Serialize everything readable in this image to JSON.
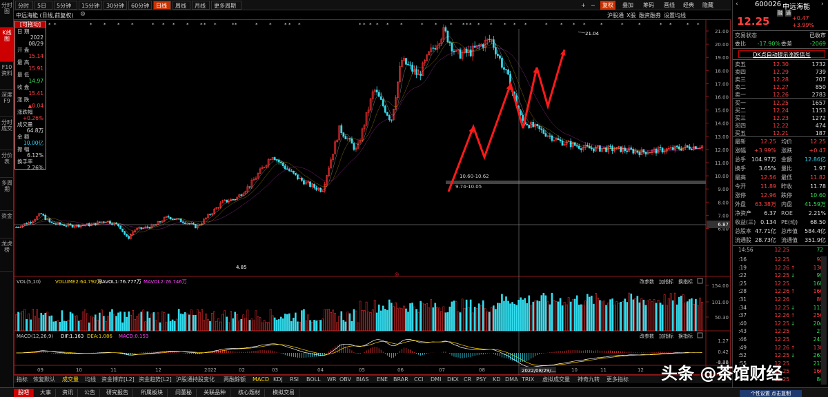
{
  "left_nav": [
    "分时图",
    "K线图",
    "F10资料",
    "深度F9",
    "分时成交",
    "分价表",
    "多周期",
    "资金",
    "龙虎榜"
  ],
  "period_tabs": [
    "分时",
    "5日",
    "5分钟",
    "15分钟",
    "30分钟",
    "60分钟",
    "日线",
    "周线",
    "月线",
    "更多周期"
  ],
  "active_period": "日线",
  "top_right": {
    "plus": "+",
    "minus": "−",
    "fuquan": "复权",
    "overlay": "叠加",
    "chouma": "筹码",
    "quxian": "画线",
    "jingdian": "经典",
    "hide": "隐藏"
  },
  "sub_header": {
    "title": "中远海能 (日线,前复权)",
    "gear": "⚙",
    "right": [
      "沪股通",
      "X股",
      "融资融券",
      "设置均线"
    ]
  },
  "info_box": {
    "header": "[可拖动]",
    "date_label": "日 期",
    "date_year": "2022",
    "date_md": "08/29",
    "open_label": "开 盘",
    "open": "15.14",
    "high_label": "最 高",
    "high": "15.91",
    "low_label": "最 低",
    "low": "14.97",
    "close_label": "收 盘",
    "close": "15.41",
    "chg_label": "涨 跌",
    "chg": "▲0.04",
    "pct_label": "涨跌幅",
    "pct": "+0.26%",
    "vol_label": "成交量",
    "vol": "64.8万",
    "amt_label": "金 额",
    "amt": "10.00亿",
    "amp_label": "振 幅",
    "amp": "6.12%",
    "turn_label": "换手率",
    "turn": "2.26%"
  },
  "annotations": {
    "high": "21.04",
    "low": "4.85",
    "range1": "10.60-10.62",
    "range2": "9.74-10.05",
    "crosshair_price": "6.87",
    "crosshair_date": "2022/08/29/—"
  },
  "y_labels": [
    "21.00",
    "20.00",
    "19.00",
    "18.00",
    "17.00",
    "16.00",
    "15.00",
    "14.00",
    "13.00",
    "12.00",
    "11.00",
    "10.00",
    "9.00",
    "8.00",
    "7.00",
    "6.00"
  ],
  "x_labels": [
    "09",
    "10",
    "11",
    "12",
    "2022",
    "02",
    "03",
    "04",
    "05",
    "06",
    "07",
    "08",
    "09",
    "10",
    "11",
    "12"
  ],
  "vol_panel": {
    "title": "VOL(5,10)",
    "v2": "VOLUME2:64.792万",
    "ma1": "MAVOL1:76.777万",
    "ma2": "MAVOL2:76.746万",
    "ticks": [
      "154.00",
      "101.00",
      "50.30"
    ],
    "right_ctl": [
      "改参数",
      "加指标",
      "换指标"
    ]
  },
  "macd_panel": {
    "title": "MACD(12,26,9)",
    "dif": "DIF:1.163",
    "dea": "DEA:1.086",
    "macd": "MACD:0.153",
    "ticks": [
      "1.27",
      "0.42",
      "-0.42",
      "-1.26"
    ],
    "right_ctl": [
      "改参数",
      "加指标",
      "换指标"
    ]
  },
  "bottom_tabs": [
    "指标",
    "恢复默认",
    "成交量",
    "均线",
    "资金博弈[L2]",
    "资金趋势[L2]",
    "沪股通持股变化",
    "两融餘额",
    "MACD",
    "KDJ",
    "RSI",
    "BOLL",
    "WR",
    "OBV",
    "BIAS",
    "ENE",
    "BRAR",
    "CCI",
    "DMI",
    "DKX",
    "CR",
    "PSY",
    "KD",
    "DMA",
    "TRIX",
    "虚拟成交量",
    "神奇九转",
    "更多指标"
  ],
  "footer_tabs": [
    "股吧",
    "大事",
    "资讯",
    "公告",
    "研究报告",
    "所属板块",
    "问董秘",
    "关联品种",
    "核心题材",
    "模拟交易"
  ],
  "stock": {
    "code": "600026",
    "name": "中远海能",
    "tag1": "融",
    "tag2": "通",
    "price": "12.25",
    "chg": "+0.47",
    "pct": "+3.99%",
    "status_label": "交易状态",
    "status": "已收市",
    "weibi_label": "委比",
    "weibi": "-17.90%",
    "weicha_label": "委差",
    "weicha": "-2069",
    "signal": "DK点自动提示涨跌信号"
  },
  "asks": [
    {
      "l": "卖五",
      "p": "12.30",
      "q": "1732"
    },
    {
      "l": "卖四",
      "p": "12.29",
      "q": "739"
    },
    {
      "l": "卖三",
      "p": "12.28",
      "q": "707"
    },
    {
      "l": "卖二",
      "p": "12.27",
      "q": "850"
    },
    {
      "l": "卖一",
      "p": "12.26",
      "q": "2783"
    }
  ],
  "bids": [
    {
      "l": "买一",
      "p": "12.25",
      "q": "1657"
    },
    {
      "l": "买二",
      "p": "12.24",
      "q": "1153"
    },
    {
      "l": "买三",
      "p": "12.23",
      "q": "1272"
    },
    {
      "l": "买四",
      "p": "12.22",
      "q": "474"
    },
    {
      "l": "买五",
      "p": "12.21",
      "q": "187"
    }
  ],
  "stats": [
    {
      "a": "最新",
      "av": "12.25",
      "ac": "red",
      "b": "均价",
      "bv": "12.25",
      "bc": "red"
    },
    {
      "a": "涨幅",
      "av": "+3.99%",
      "ac": "red",
      "b": "涨跌",
      "bv": "+0.47",
      "bc": "red"
    },
    {
      "a": "总手",
      "av": "104.97万",
      "ac": "wht",
      "b": "金额",
      "bv": "12.86亿",
      "bc": "cyn"
    },
    {
      "a": "换手",
      "av": "3.65%",
      "ac": "wht",
      "b": "量比",
      "bv": "1.97",
      "bc": "wht"
    },
    {
      "a": "最高",
      "av": "12.56",
      "ac": "red",
      "b": "最低",
      "bv": "11.82",
      "bc": "red"
    },
    {
      "a": "今开",
      "av": "11.89",
      "ac": "red",
      "b": "昨收",
      "bv": "11.78",
      "bc": "wht"
    },
    {
      "a": "涨停",
      "av": "12.96",
      "ac": "red",
      "b": "跌停",
      "bv": "10.60",
      "bc": "grn"
    },
    {
      "a": "外盘",
      "av": "63.38万",
      "ac": "red",
      "b": "内盘",
      "bv": "41.59万",
      "bc": "grn"
    },
    {
      "a": "净资产",
      "av": "6.37",
      "ac": "wht",
      "b": "ROE",
      "bv": "2.21%",
      "bc": "wht"
    },
    {
      "a": "收益(三)",
      "av": "0.134",
      "ac": "wht",
      "b": "PE(动)",
      "bv": "68.50",
      "bc": "wht"
    },
    {
      "a": "总股本",
      "av": "47.71亿",
      "ac": "wht",
      "b": "总市值",
      "bv": "584.4亿",
      "bc": "wht"
    },
    {
      "a": "流通股",
      "av": "28.73亿",
      "ac": "wht",
      "b": "流通值",
      "bv": "351.9亿",
      "bc": "wht"
    }
  ],
  "ticks_header": {
    "time": "14:56",
    "p": "12.25",
    "q": "72"
  },
  "ticks": [
    {
      "t": ":16",
      "p": "12.25",
      "a": "",
      "q": "92",
      "c": "red"
    },
    {
      "t": ":19",
      "p": "12.26",
      "a": "↑",
      "q": "136",
      "c": "red"
    },
    {
      "t": ":22",
      "p": "12.25",
      "a": "↓",
      "q": "99",
      "c": "grn"
    },
    {
      "t": ":25",
      "p": "12.25",
      "a": "",
      "q": "168",
      "c": "grn"
    },
    {
      "t": ":28",
      "p": "12.26",
      "a": "↑",
      "q": "166",
      "c": "red"
    },
    {
      "t": ":31",
      "p": "12.26",
      "a": "",
      "q": "89",
      "c": "red"
    },
    {
      "t": ":34",
      "p": "12.25",
      "a": "↓",
      "q": "111",
      "c": "grn"
    },
    {
      "t": ":37",
      "p": "12.26",
      "a": "↑",
      "q": "256",
      "c": "red"
    },
    {
      "t": ":40",
      "p": "12.25",
      "a": "↓",
      "q": "204",
      "c": "grn"
    },
    {
      "t": ":43",
      "p": "12.25",
      "a": "",
      "q": "27",
      "c": "grn"
    },
    {
      "t": ":46",
      "p": "12.25",
      "a": "",
      "q": "243",
      "c": "grn"
    },
    {
      "t": ":49",
      "p": "12.26",
      "a": "↑",
      "q": "130",
      "c": "red"
    },
    {
      "t": ":52",
      "p": "12.25",
      "a": "↓",
      "q": "261",
      "c": "grn"
    },
    {
      "t": ":55",
      "p": "12.25",
      "a": "",
      "q": "217",
      "c": "grn"
    },
    {
      "t": ":58",
      "p": "12.25",
      "a": "",
      "q": "166",
      "c": "red"
    },
    {
      "t": ":01",
      "p": "12.25",
      "a": "",
      "q": "84",
      "c": "grn"
    }
  ],
  "watermark": "头条 @茶馆财经",
  "toast": "个性设置 点击复制",
  "colors": {
    "up": "#ff3232",
    "down": "#33ddee",
    "accent": "#c83200"
  }
}
